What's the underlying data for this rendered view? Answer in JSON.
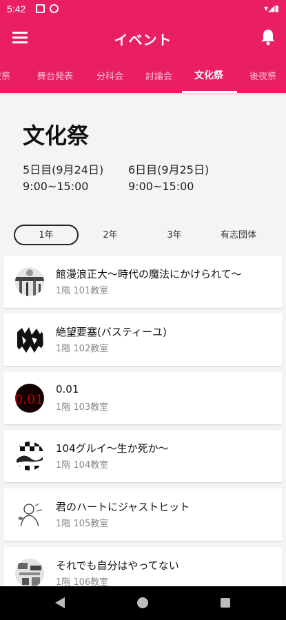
{
  "status": {
    "time": "5:42",
    "right": "▾◢▮"
  },
  "appbar": {
    "title": "イベント"
  },
  "tabs": [
    {
      "label": "前夜祭"
    },
    {
      "label": "舞台発表"
    },
    {
      "label": "分科会"
    },
    {
      "label": "討論会"
    },
    {
      "label": "文化祭"
    },
    {
      "label": "後夜祭"
    }
  ],
  "main": {
    "title": "文化祭",
    "day1": {
      "date": "5日目(9月24日)",
      "time": "9:00~15:00"
    },
    "day2": {
      "date": "6日目(9月25日)",
      "time": "9:00~15:00"
    }
  },
  "grades": [
    {
      "label": "1年"
    },
    {
      "label": "2年"
    },
    {
      "label": "3年"
    },
    {
      "label": "有志団体"
    }
  ],
  "events": [
    {
      "title": "館漫浪正大～時代の魔法にかけられて～",
      "room": "1階 101教室"
    },
    {
      "title": "絶望要塞(バスティーユ)",
      "room": "1階 102教室"
    },
    {
      "title": "0.01",
      "room": "1階 103教室",
      "logo": "0.01"
    },
    {
      "title": "104グルイ～生か死か～",
      "room": "1階 104教室"
    },
    {
      "title": "君のハートにジャストヒット",
      "room": "1階 105教室"
    },
    {
      "title": "それでも自分はやってない",
      "room": "1階 106教室"
    }
  ],
  "colors": {
    "primary": "#e91e63",
    "background": "#f4f4f4"
  }
}
